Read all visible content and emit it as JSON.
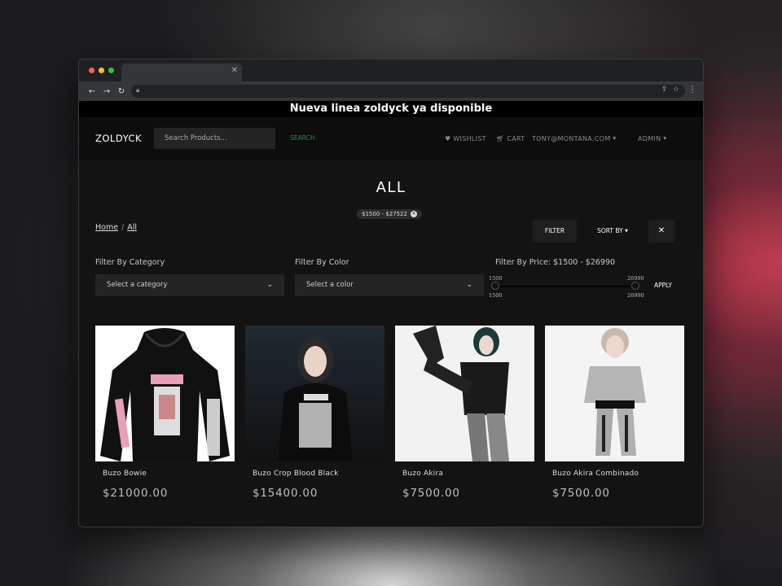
{
  "announcement": "Nueva linea zoldyck ya disponible",
  "navbar": {
    "brand": "ZOLDYCK",
    "search_placeholder": "Search Products...",
    "search_label": "SEARCH",
    "wishlist": "WISHLIST",
    "cart": "CART",
    "account": "TONY@MONTANA.COM",
    "admin": "ADMIN"
  },
  "page": {
    "title": "ALL",
    "price_chip": "$1500 - $27522",
    "breadcrumb": [
      "Home",
      "All"
    ],
    "buttons": {
      "filter": "FILTER",
      "sort": "SORT BY",
      "close": "✕"
    }
  },
  "filters": {
    "category_label": "Filter By Category",
    "category_placeholder": "Select a category",
    "color_label": "Filter By Color",
    "color_placeholder": "Select a color",
    "price_label": "Filter By Price: $1500 - $26990",
    "price_min": "1500",
    "price_max": "26990",
    "apply": "APPLY"
  },
  "products": [
    {
      "name": "Buzo Bowie",
      "price": "$21000.00"
    },
    {
      "name": "Buzo Crop Blood Black",
      "price": "$15400.00"
    },
    {
      "name": "Buzo Akira",
      "price": "$7500.00"
    },
    {
      "name": "Buzo Akira Combinado",
      "price": "$7500.00"
    }
  ]
}
